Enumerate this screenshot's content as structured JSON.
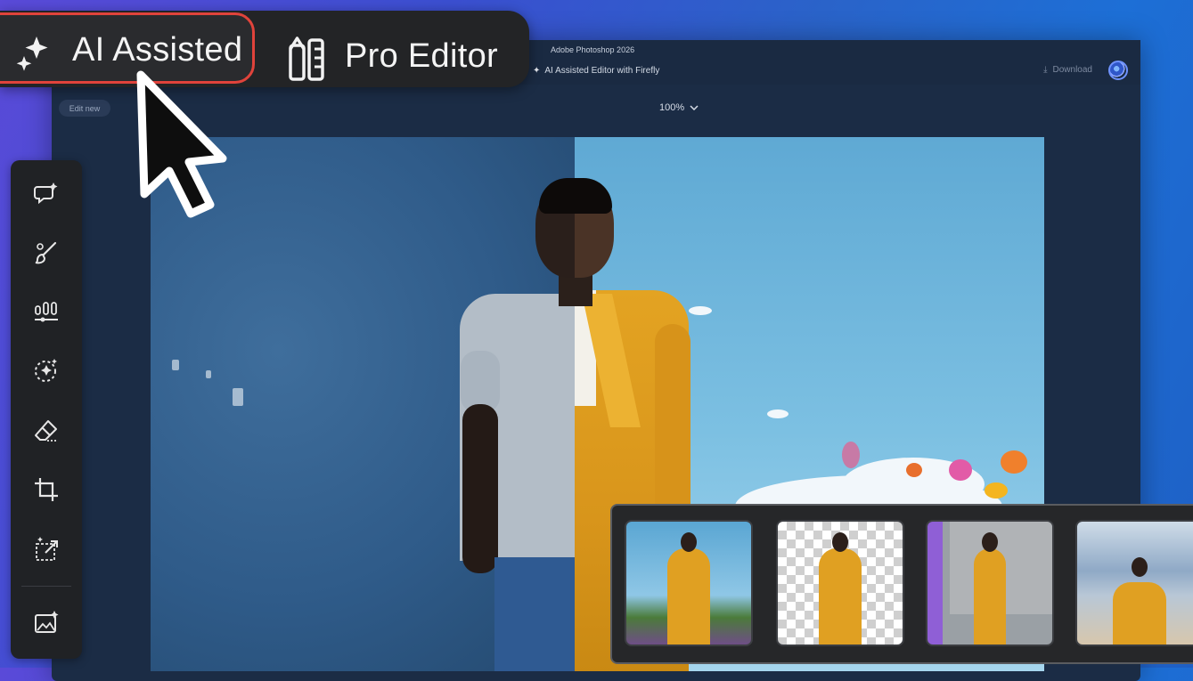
{
  "app": {
    "title": "Adobe Photoshop 2026",
    "subtitle": "AI Assisted Editor with Firefly",
    "download_label": "Download",
    "edit_new_label": "Edit new",
    "zoom_label": "100%"
  },
  "mode_switch": {
    "ai_label": "AI Assisted",
    "pro_label": "Pro Editor"
  },
  "icons": {
    "sparkle": "sparkle-icon",
    "pro": "pencil-ruler-icon",
    "download": "download-icon",
    "chevron": "chevron-down-icon"
  },
  "colors": {
    "accent_red": "#e0433b",
    "rail": "#202225",
    "suit": "#e0a022"
  },
  "toolbar": {
    "tools": [
      "chat-sparkle-icon",
      "brush-icon",
      "adjustments-icon",
      "selection-sparkle-icon",
      "eraser-icon",
      "crop-icon",
      "generative-expand-icon",
      "image-sparkle-icon"
    ]
  },
  "variations": {
    "count": 4
  }
}
